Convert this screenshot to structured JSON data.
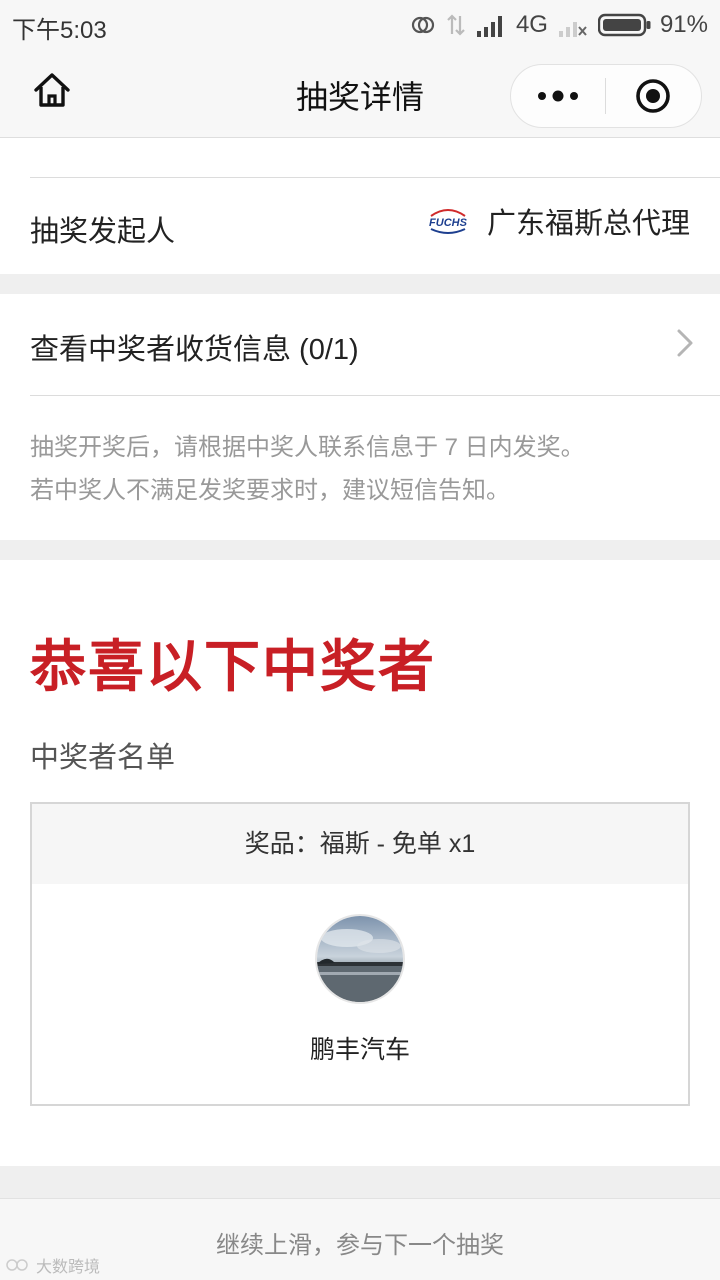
{
  "status_bar": {
    "time": "下午5:03",
    "network": "4G",
    "battery": "91%"
  },
  "nav": {
    "title": "抽奖详情",
    "home_icon": "home-icon",
    "more_icon": "more-dots-icon",
    "close_icon": "target-close-icon"
  },
  "initiator": {
    "label": "抽奖发起人",
    "logo_text": "FUCHS",
    "name": "广东福斯总代理"
  },
  "receipt": {
    "label": "查看中奖者收货信息 (0/1)",
    "notice_line1": "抽奖开奖后，请根据中奖人联系信息于 7 日内发奖。",
    "notice_line2": "若中奖人不满足发奖要求时，建议短信告知。"
  },
  "winners": {
    "headline": "恭喜以下中奖者",
    "list_title": "中奖者名单",
    "prize": "奖品：福斯 - 免单 x1",
    "winner_name": "鹏丰汽车"
  },
  "footer": {
    "hint": "继续上滑，参与下一个抽奖",
    "watermark": "大数跨境"
  },
  "colors": {
    "accent_red": "#c81f25",
    "gap_gray": "#efefef",
    "muted_text": "#999999"
  }
}
